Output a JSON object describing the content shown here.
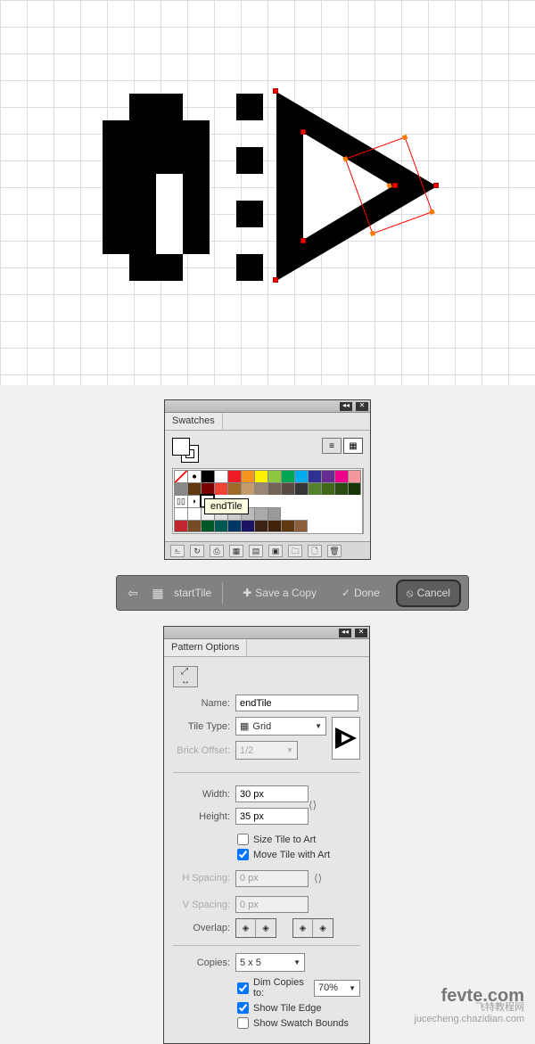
{
  "swatches": {
    "tab": "Swatches",
    "tooltip": "endTile",
    "pattern_swatches": [
      "▯▯",
      "◗",
      "▷"
    ],
    "colors_row1": [
      "#ffffff",
      "#ffffff",
      "#000000",
      "#ffffff",
      "#ed1c24",
      "#f7941d",
      "#fff200",
      "#8dc63f",
      "#00a651",
      "#00aeef",
      "#2e3192",
      "#662d91",
      "#ec008c",
      "#f5989d"
    ],
    "colors_row2": [
      "#898989",
      "#603913",
      "#790000",
      "#ef4136",
      "#9e6b29",
      "#c69c6d",
      "#998675",
      "#736357",
      "#594a42",
      "#363636",
      "#54812d",
      "#406618",
      "#2a4b12",
      "#173506"
    ],
    "colors_row3": [
      "#c0272d",
      "#754c24",
      "#005826",
      "#005952",
      "#003663",
      "#1b1464",
      "#3b2314",
      "#42210b",
      "#603913",
      "#8b5e3c"
    ],
    "grays": [
      "#ffffff",
      "#eeeeee",
      "#dddddd",
      "#cccccc",
      "#bbbbbb",
      "#aaaaaa",
      "#999999"
    ],
    "footer_icons": [
      "⎁",
      "↻",
      "⎙",
      "▦",
      "▤",
      "▣",
      "🗀",
      "🗋",
      "🗑"
    ]
  },
  "toolbar": {
    "pattern_label": "startTile",
    "save": "Save a Copy",
    "done": "Done",
    "cancel": "Cancel"
  },
  "pattern_options": {
    "tab": "Pattern Options",
    "name_label": "Name:",
    "name_value": "endTile",
    "tiletype_label": "Tile Type:",
    "tiletype_value": "Grid",
    "brick_label": "Brick Offset:",
    "brick_value": "1/2",
    "width_label": "Width:",
    "width_value": "30 px",
    "height_label": "Height:",
    "height_value": "35 px",
    "size_to_art": "Size Tile to Art",
    "move_with_art": "Move Tile with Art",
    "hspacing_label": "H Spacing:",
    "hspacing_value": "0 px",
    "vspacing_label": "V Spacing:",
    "vspacing_value": "0 px",
    "overlap_label": "Overlap:",
    "copies_label": "Copies:",
    "copies_value": "5 x 5",
    "dim_copies": "Dim Copies to:",
    "dim_value": "70%",
    "show_edge": "Show Tile Edge",
    "show_bounds": "Show Swatch Bounds"
  },
  "watermark": {
    "line1": "fevte.com",
    "line2": "飞特教程网",
    "line3": "jucecheng.chazidian.com"
  }
}
